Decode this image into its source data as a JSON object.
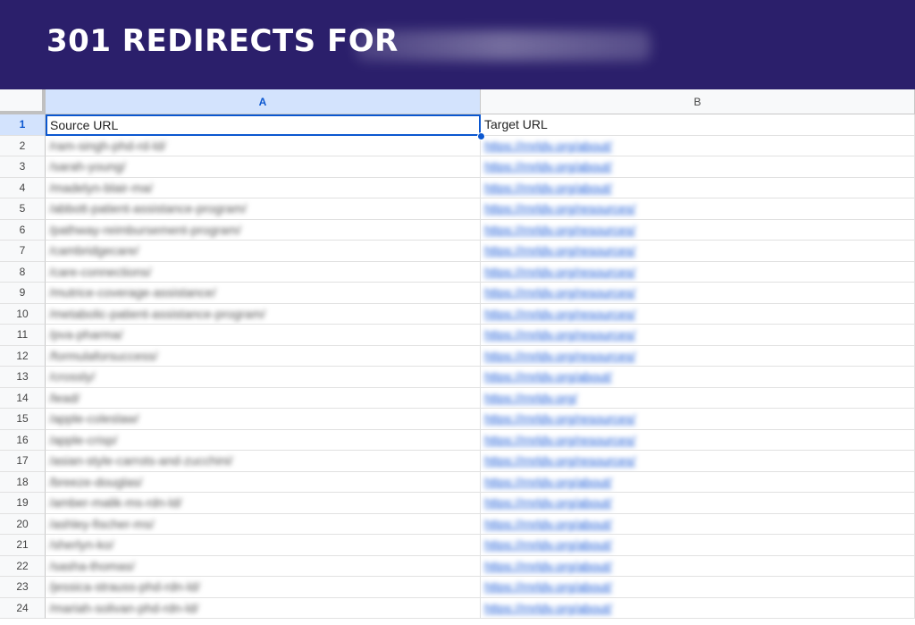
{
  "banner": {
    "title": "301 REDIRECTS FOR",
    "redacted_text": "THE BLANK CLIENT",
    "background_color": "#2b1f6b"
  },
  "spreadsheet": {
    "columns": [
      "A",
      "B"
    ],
    "selected_column": "A",
    "header_row": {
      "number": "1",
      "source": "Source URL",
      "target": "Target URL"
    },
    "rows": [
      {
        "n": "2",
        "source": "/ram-singh-phd-rd-ld/",
        "target": "https://rnrldv.org/about/"
      },
      {
        "n": "3",
        "source": "/sarah-young/",
        "target": "https://rnrldv.org/about/"
      },
      {
        "n": "4",
        "source": "/madelyn-blair-ma/",
        "target": "https://rnrldv.org/about/"
      },
      {
        "n": "5",
        "source": "/abbott-patient-assistance-program/",
        "target": "https://rnrldv.org/resources/"
      },
      {
        "n": "6",
        "source": "/pathway-reimbursement-program/",
        "target": "https://rnrldv.org/resources/"
      },
      {
        "n": "7",
        "source": "/cambridgecare/",
        "target": "https://rnrldv.org/resources/"
      },
      {
        "n": "8",
        "source": "/care-connections/",
        "target": "https://rnrldv.org/resources/"
      },
      {
        "n": "9",
        "source": "/mutrice-coverage-assistance/",
        "target": "https://rnrldv.org/resources/"
      },
      {
        "n": "10",
        "source": "/metabolic-patient-assistance-program/",
        "target": "https://rnrldv.org/resources/"
      },
      {
        "n": "11",
        "source": "/pva-pharma/",
        "target": "https://rnrldv.org/resources/"
      },
      {
        "n": "12",
        "source": "/formulaforsuccess/",
        "target": "https://rnrldv.org/resources/"
      },
      {
        "n": "13",
        "source": "/crossly/",
        "target": "https://rnrldv.org/about/"
      },
      {
        "n": "14",
        "source": "/lead/",
        "target": "https://rnrldv.org/"
      },
      {
        "n": "15",
        "source": "/apple-coleslaw/",
        "target": "https://rnrldv.org/resources/"
      },
      {
        "n": "16",
        "source": "/apple-crisp/",
        "target": "https://rnrldv.org/resources/"
      },
      {
        "n": "17",
        "source": "/asian-style-carrots-and-zucchini/",
        "target": "https://rnrldv.org/resources/"
      },
      {
        "n": "18",
        "source": "/breeze-douglas/",
        "target": "https://rnrldv.org/about/"
      },
      {
        "n": "19",
        "source": "/amber-malik-ms-rdn-ld/",
        "target": "https://rnrldv.org/about/"
      },
      {
        "n": "20",
        "source": "/ashley-fischer-ms/",
        "target": "https://rnrldv.org/about/"
      },
      {
        "n": "21",
        "source": "/sherlyn-ko/",
        "target": "https://rnrldv.org/about/"
      },
      {
        "n": "22",
        "source": "/sasha-thomas/",
        "target": "https://rnrldv.org/about/"
      },
      {
        "n": "23",
        "source": "/jessica-strauss-phd-rdn-ld/",
        "target": "https://rnrldv.org/about/"
      },
      {
        "n": "24",
        "source": "/mariah-solivan-phd-rdn-ld/",
        "target": "https://rnrldv.org/about/"
      }
    ]
  },
  "colors": {
    "selection": "#0b57d0",
    "link": "#1a5bd8",
    "header_bg": "#f8f9fa"
  }
}
